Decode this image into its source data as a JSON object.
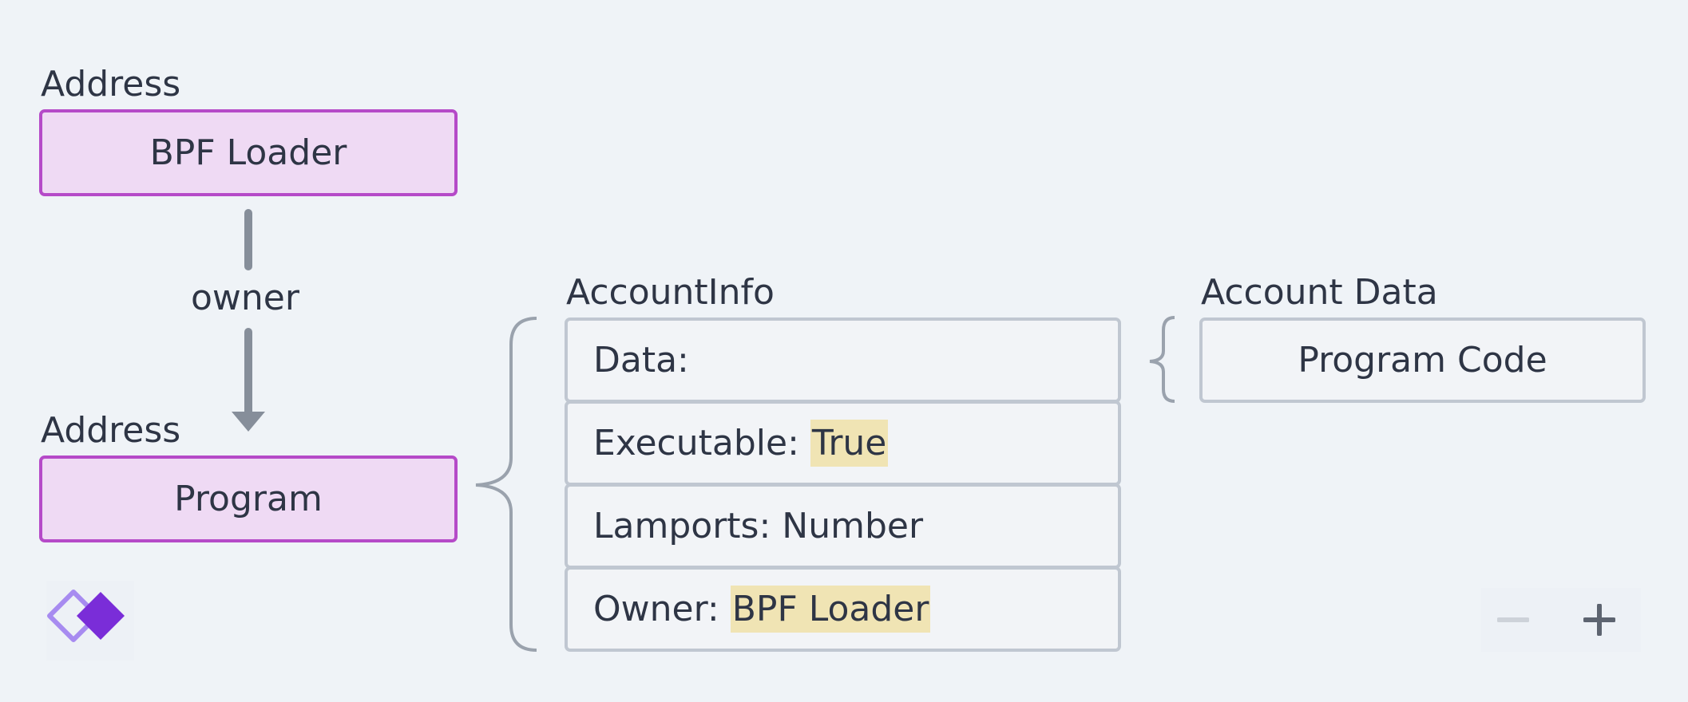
{
  "diagram": {
    "bpf_loader_node": {
      "caption": "Address",
      "label": "BPF Loader"
    },
    "edge_label": "owner",
    "program_node": {
      "caption": "Address",
      "label": "Program"
    },
    "account_info": {
      "title": "AccountInfo",
      "rows": [
        {
          "key": "Data:",
          "value": ""
        },
        {
          "key": "Executable:",
          "value": "True"
        },
        {
          "key": "Lamports:",
          "value": "Number"
        },
        {
          "key": "Owner:",
          "value": "BPF Loader"
        }
      ]
    },
    "account_data": {
      "title": "Account Data",
      "label": "Program Code"
    }
  },
  "controls": {
    "zoom_out_icon": "minus-icon",
    "zoom_in_icon": "plus-icon",
    "logo_icon": "diamond-logo-icon"
  },
  "colors": {
    "background": "#eff3f7",
    "node_fill": "#efdaf4",
    "node_border": "#b54ac8",
    "row_border": "#c0c7d1",
    "connector": "#868e9a",
    "highlight": "#f0e4b4",
    "logo_primary": "#7a2dd8",
    "logo_secondary": "#a78bf0"
  }
}
